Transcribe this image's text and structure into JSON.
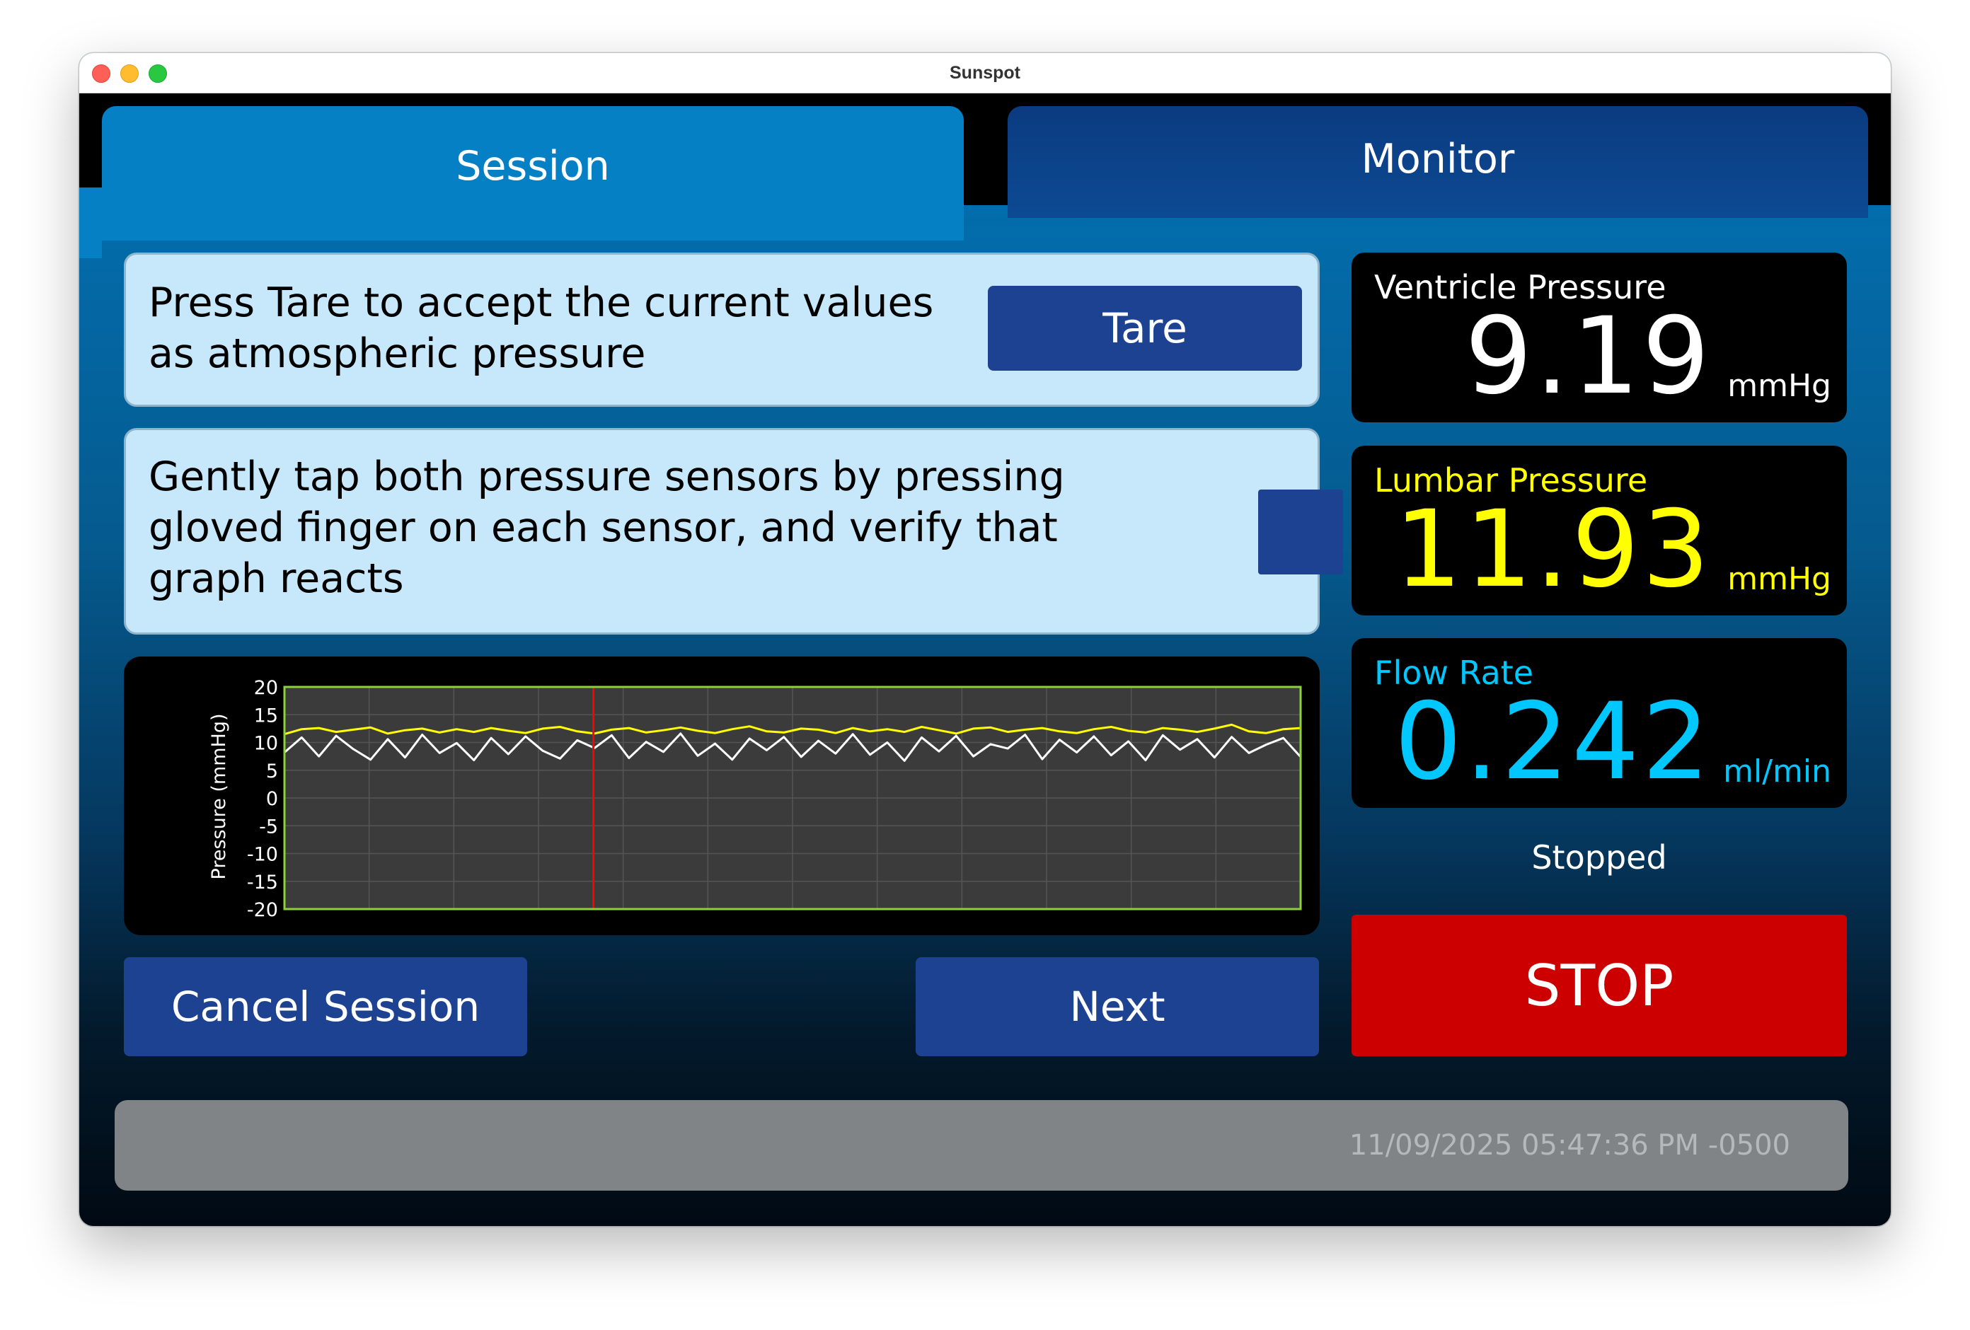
{
  "window": {
    "title": "Sunspot"
  },
  "tabs": [
    {
      "label": "Session",
      "active": true
    },
    {
      "label": "Monitor",
      "active": false
    }
  ],
  "steps": [
    {
      "text_line1": "Press Tare to accept the current values",
      "text_line2": "as atmospheric pressure",
      "button_label": "Tare"
    },
    {
      "text_line1": "Gently tap both pressure sensors by pressing",
      "text_line2": "gloved finger on each sensor, and verify that",
      "text_line3": "graph reacts",
      "checkbox_checked": false
    }
  ],
  "chart_data": {
    "type": "line",
    "ylabel": "Pressure (mmHg)",
    "ylim": [
      -20,
      20
    ],
    "yticks": [
      "20",
      "15",
      "10",
      "5",
      "0",
      "-5",
      "-10",
      "-15",
      "-20"
    ],
    "grid": true,
    "cursor_fraction": 0.304,
    "colors": {
      "ventricle": "#ffffff",
      "lumbar": "#ffff00",
      "frame": "#8bd13b",
      "cursor": "#ff0000"
    },
    "series": [
      {
        "color": "lumbar",
        "values": [
          11.5,
          12.4,
          12.6,
          11.9,
          12.3,
          12.7,
          11.6,
          12.2,
          12.5,
          11.8,
          12.4,
          11.9,
          12.6,
          12.1,
          11.7,
          12.5,
          12.8,
          12.0,
          11.6,
          12.3,
          12.6,
          11.8,
          12.2,
          12.7,
          12.1,
          11.7,
          12.4,
          12.9,
          12.0,
          11.8,
          12.5,
          12.3,
          11.7,
          12.6,
          12.0,
          12.4,
          11.9,
          12.8,
          12.2,
          11.6,
          12.5,
          12.7,
          11.9,
          12.3,
          12.6,
          12.0,
          11.7,
          12.4,
          12.8,
          12.1,
          11.8,
          12.6,
          12.3,
          11.9,
          12.5,
          13.2,
          12.0,
          11.7,
          12.4,
          12.6
        ]
      },
      {
        "color": "ventricle",
        "values": [
          8.2,
          10.9,
          7.5,
          11.2,
          8.8,
          6.9,
          10.6,
          7.3,
          11.4,
          8.1,
          9.9,
          6.8,
          10.8,
          7.9,
          11.1,
          8.5,
          7.1,
          10.4,
          9.0,
          11.3,
          7.2,
          10.1,
          8.3,
          11.6,
          7.6,
          9.8,
          6.9,
          10.7,
          8.6,
          11.0,
          7.4,
          10.3,
          8.0,
          11.5,
          7.8,
          10.0,
          6.7,
          10.9,
          8.4,
          11.2,
          7.5,
          9.7,
          8.9,
          11.4,
          7.0,
          10.5,
          8.2,
          11.1,
          7.7,
          10.2,
          6.8,
          11.3,
          8.7,
          10.6,
          7.3,
          11.0,
          8.1,
          9.6,
          10.8,
          7.4
        ]
      }
    ]
  },
  "readouts": [
    {
      "label": "Ventricle Pressure",
      "value": "9.19",
      "unit": "mmHg",
      "color": "#ffffff"
    },
    {
      "label": "Lumbar Pressure",
      "value": "11.93",
      "unit": "mmHg",
      "color": "#ffff00"
    },
    {
      "label": "Flow Rate",
      "value": "0.242",
      "unit": "ml/min",
      "color": "#00c8ff"
    }
  ],
  "pump_status": "Stopped",
  "buttons": {
    "cancel_label": "Cancel Session",
    "next_label": "Next",
    "stop_label": "STOP"
  },
  "statusbar": {
    "timestamp": "11/09/2025 05:47:36 PM -0500"
  }
}
